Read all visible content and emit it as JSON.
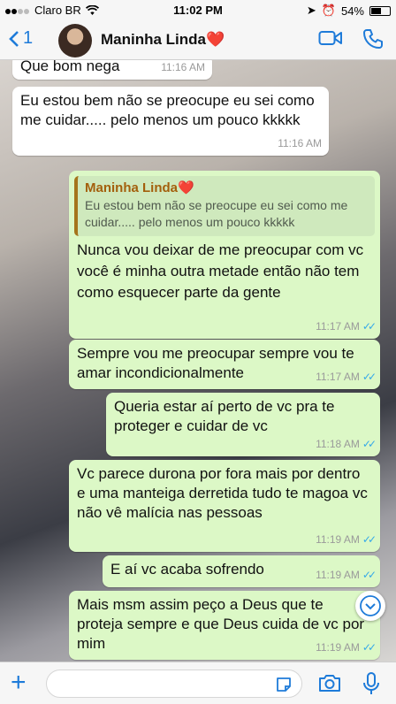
{
  "status_bar": {
    "carrier": "Claro BR",
    "time": "11:02 PM",
    "battery": "54%"
  },
  "header": {
    "back_count": "1",
    "contact_name": "Maninha Linda",
    "contact_heart": "❤️"
  },
  "messages": [
    {
      "direction": "in",
      "text": "Que bom nega",
      "time": "11:16 AM"
    },
    {
      "direction": "in",
      "text": "Eu estou bem não se preocupe eu sei como me cuidar..... pelo menos um pouco kkkkk",
      "time": "11:16 AM"
    },
    {
      "direction": "out",
      "quote_name": "Maninha Linda",
      "quote_heart": "❤️",
      "quote_text": "Eu estou bem não se preocupe eu sei como me cuidar..... pelo menos um pouco kkkkk",
      "text": "Nunca vou deixar de me preocupar com vc você é minha outra metade então não tem como esquecer parte da gente",
      "time": "11:17 AM"
    },
    {
      "direction": "out",
      "text": "Sempre vou me preocupar sempre vou te amar incondicionalmente",
      "time": "11:17 AM"
    },
    {
      "direction": "out",
      "text": "Queria estar aí perto de vc pra te proteger e cuidar de vc",
      "time": "11:18 AM"
    },
    {
      "direction": "out",
      "text": "Vc parece durona por fora mais por dentro e uma manteiga derretida tudo te magoa vc não vê malícia nas pessoas",
      "time": "11:19 AM"
    },
    {
      "direction": "out",
      "text": "E aí vc acaba sofrendo",
      "time": "11:19 AM"
    },
    {
      "direction": "out",
      "text": "Mais msm assim peço a Deus que te proteja sempre e que Deus cuida de vc por mim",
      "time": "11:19 AM"
    }
  ],
  "colors": {
    "accent": "#1e7bd9",
    "outgoing_bubble": "#dcf8c6",
    "incoming_bubble": "#ffffff",
    "read_ticks": "#35a9e9",
    "quote_name": "#a35f0c"
  }
}
